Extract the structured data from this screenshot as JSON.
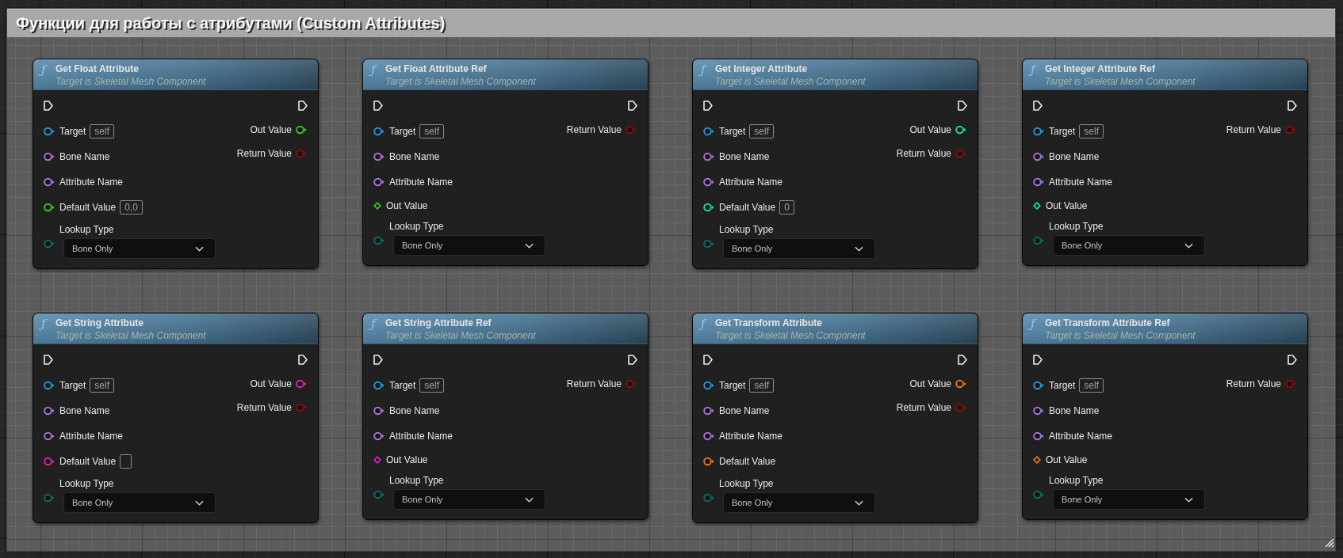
{
  "comment": {
    "title": "Функции для работы с атрибутами (Custom Attributes)"
  },
  "nodes": [
    {
      "glyph": "ƒ",
      "title": "Get Float Attribute",
      "subtitle": "Target is Skeletal Mesh Component",
      "inputs": [
        {
          "kind": "pin",
          "label": "Target",
          "color": "#1f98dc",
          "field": true,
          "value": "self"
        },
        {
          "kind": "pin",
          "label": "Bone Name",
          "color": "#a874d6",
          "field": false
        },
        {
          "kind": "pin",
          "label": "Attribute Name",
          "color": "#a874d6",
          "field": false
        },
        {
          "kind": "pin",
          "label": "Default Value",
          "color": "#3ec71a",
          "field": true,
          "value": "0,0"
        },
        {
          "kind": "dropdown",
          "label": "Lookup Type",
          "color": "#0b6b66",
          "value": "Bone Only"
        }
      ],
      "outputs": [
        {
          "label": "Out Value",
          "color": "#3ec71a"
        },
        {
          "label": "Return Value",
          "color": "#8e0b0b"
        }
      ]
    },
    {
      "glyph": "ƒ",
      "title": "Get Float Attribute Ref",
      "subtitle": "Target is Skeletal Mesh Component",
      "inputs": [
        {
          "kind": "pin",
          "label": "Target",
          "color": "#1f98dc",
          "field": true,
          "value": "self"
        },
        {
          "kind": "pin",
          "label": "Bone Name",
          "color": "#a874d6",
          "field": false
        },
        {
          "kind": "pin",
          "label": "Attribute Name",
          "color": "#a874d6",
          "field": false
        },
        {
          "kind": "ref",
          "label": "Out Value",
          "color": "#3ec71a"
        },
        {
          "kind": "dropdown",
          "label": "Lookup Type",
          "color": "#0b6b66",
          "value": "Bone Only"
        }
      ],
      "outputs": [
        {
          "label": "Return Value",
          "color": "#8e0b0b"
        }
      ]
    },
    {
      "glyph": "ƒ",
      "title": "Get Integer Attribute",
      "subtitle": "Target is Skeletal Mesh Component",
      "inputs": [
        {
          "kind": "pin",
          "label": "Target",
          "color": "#1f98dc",
          "field": true,
          "value": "self"
        },
        {
          "kind": "pin",
          "label": "Bone Name",
          "color": "#a874d6",
          "field": false
        },
        {
          "kind": "pin",
          "label": "Attribute Name",
          "color": "#a874d6",
          "field": false
        },
        {
          "kind": "pin",
          "label": "Default Value",
          "color": "#1dd8ae",
          "field": true,
          "value": "0"
        },
        {
          "kind": "dropdown",
          "label": "Lookup Type",
          "color": "#0b6b66",
          "value": "Bone Only"
        }
      ],
      "outputs": [
        {
          "label": "Out Value",
          "color": "#1dd8ae"
        },
        {
          "label": "Return Value",
          "color": "#8e0b0b"
        }
      ]
    },
    {
      "glyph": "ƒ",
      "title": "Get Integer Attribute Ref",
      "subtitle": "Target is Skeletal Mesh Component",
      "inputs": [
        {
          "kind": "pin",
          "label": "Target",
          "color": "#1f98dc",
          "field": true,
          "value": "self"
        },
        {
          "kind": "pin",
          "label": "Bone Name",
          "color": "#a874d6",
          "field": false
        },
        {
          "kind": "pin",
          "label": "Attribute Name",
          "color": "#a874d6",
          "field": false
        },
        {
          "kind": "ref",
          "label": "Out Value",
          "color": "#1dd8ae"
        },
        {
          "kind": "dropdown",
          "label": "Lookup Type",
          "color": "#0b6b66",
          "value": "Bone Only"
        }
      ],
      "outputs": [
        {
          "label": "Return Value",
          "color": "#8e0b0b"
        }
      ]
    },
    {
      "glyph": "ƒ",
      "title": "Get String Attribute",
      "subtitle": "Target is Skeletal Mesh Component",
      "inputs": [
        {
          "kind": "pin",
          "label": "Target",
          "color": "#1f98dc",
          "field": true,
          "value": "self"
        },
        {
          "kind": "pin",
          "label": "Bone Name",
          "color": "#a874d6",
          "field": false
        },
        {
          "kind": "pin",
          "label": "Attribute Name",
          "color": "#a874d6",
          "field": false
        },
        {
          "kind": "pin",
          "label": "Default Value",
          "color": "#e01cc0",
          "field": true
        },
        {
          "kind": "dropdown",
          "label": "Lookup Type",
          "color": "#0b6b66",
          "value": "Bone Only"
        }
      ],
      "outputs": [
        {
          "label": "Out Value",
          "color": "#e01cc0"
        },
        {
          "label": "Return Value",
          "color": "#8e0b0b"
        }
      ]
    },
    {
      "glyph": "ƒ",
      "title": "Get String Attribute Ref",
      "subtitle": "Target is Skeletal Mesh Component",
      "inputs": [
        {
          "kind": "pin",
          "label": "Target",
          "color": "#1f98dc",
          "field": true,
          "value": "self"
        },
        {
          "kind": "pin",
          "label": "Bone Name",
          "color": "#a874d6",
          "field": false
        },
        {
          "kind": "pin",
          "label": "Attribute Name",
          "color": "#a874d6",
          "field": false
        },
        {
          "kind": "ref",
          "label": "Out Value",
          "color": "#e01cc0"
        },
        {
          "kind": "dropdown",
          "label": "Lookup Type",
          "color": "#0b6b66",
          "value": "Bone Only"
        }
      ],
      "outputs": [
        {
          "label": "Return Value",
          "color": "#8e0b0b"
        }
      ]
    },
    {
      "glyph": "ƒ",
      "title": "Get Transform Attribute",
      "subtitle": "Target is Skeletal Mesh Component",
      "inputs": [
        {
          "kind": "pin",
          "label": "Target",
          "color": "#1f98dc",
          "field": true,
          "value": "self"
        },
        {
          "kind": "pin",
          "label": "Bone Name",
          "color": "#a874d6",
          "field": false
        },
        {
          "kind": "pin",
          "label": "Attribute Name",
          "color": "#a874d6",
          "field": false
        },
        {
          "kind": "pin",
          "label": "Default Value",
          "color": "#ec7410",
          "field": false
        },
        {
          "kind": "dropdown",
          "label": "Lookup Type",
          "color": "#0b6b66",
          "value": "Bone Only"
        }
      ],
      "outputs": [
        {
          "label": "Out Value",
          "color": "#ec7410"
        },
        {
          "label": "Return Value",
          "color": "#8e0b0b"
        }
      ]
    },
    {
      "glyph": "ƒ",
      "title": "Get Transform Attribute Ref",
      "subtitle": "Target is Skeletal Mesh Component",
      "inputs": [
        {
          "kind": "pin",
          "label": "Target",
          "color": "#1f98dc",
          "field": true,
          "value": "self"
        },
        {
          "kind": "pin",
          "label": "Bone Name",
          "color": "#a874d6",
          "field": false
        },
        {
          "kind": "pin",
          "label": "Attribute Name",
          "color": "#a874d6",
          "field": false
        },
        {
          "kind": "ref",
          "label": "Out Value",
          "color": "#ec7410"
        },
        {
          "kind": "dropdown",
          "label": "Lookup Type",
          "color": "#0b6b66",
          "value": "Bone Only"
        }
      ],
      "outputs": [
        {
          "label": "Return Value",
          "color": "#8e0b0b"
        }
      ]
    }
  ]
}
